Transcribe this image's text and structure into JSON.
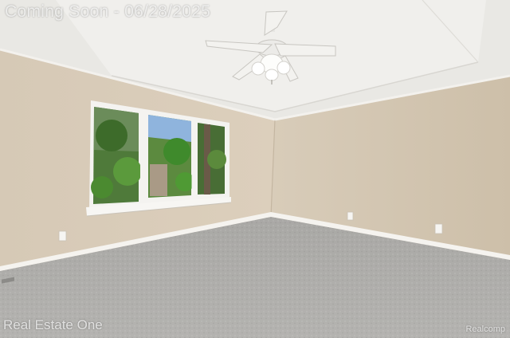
{
  "photo": {
    "subject": "empty-bedroom-with-ceiling-fan",
    "icons": [
      "ceiling-fan-icon",
      "window",
      "electrical-outlet"
    ],
    "colors": {
      "wall": "#d3c7b5",
      "wall_shadow": "#c3b59f",
      "ceiling": "#eceae6",
      "trim": "#f4f2ee",
      "carpet": "#a8a7a4",
      "foliage": "#3f7a2f",
      "sky": "#8fb4dd"
    }
  },
  "watermarks": {
    "top": "Coming Soon - 06/28/2025",
    "bottom_left": "Real Estate One",
    "bottom_right": "Realcomp"
  }
}
